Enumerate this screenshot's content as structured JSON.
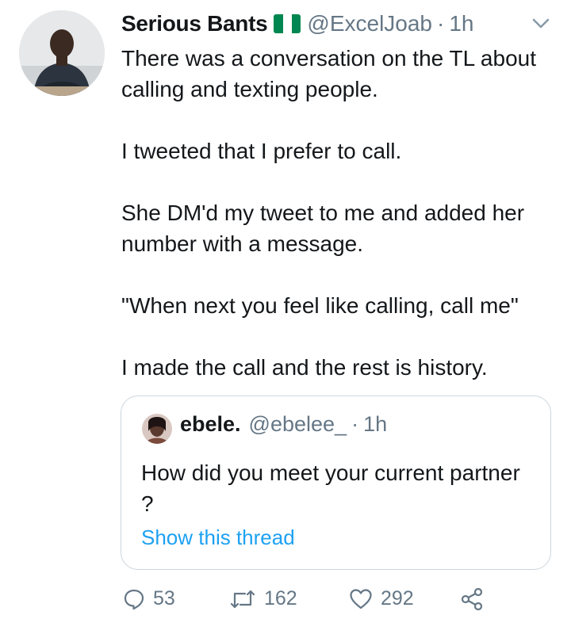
{
  "tweet": {
    "author_name": "Serious Bants",
    "flag": "nigeria-flag",
    "handle": "@ExcelJoab",
    "separator": "·",
    "time": "1h",
    "paragraphs": [
      "There was a conversation on the TL about calling and texting people.",
      "I tweeted that I prefer to call.",
      "She DM'd my tweet to me and added her number with a message.",
      "\"When next you feel like calling, call me\"",
      "I made the call and the rest is history."
    ]
  },
  "quoted": {
    "author_name": "ebele.",
    "handle": "@ebelee_",
    "separator": "·",
    "time": "1h",
    "text": "How did you meet your current partner ?",
    "link": "Show this thread"
  },
  "actions": {
    "replies": "53",
    "retweets": "162",
    "likes": "292"
  },
  "colors": {
    "text": "#14171a",
    "secondary": "#657786",
    "link": "#1da1f2",
    "border": "#ccd6dd",
    "flag_green": "#008751"
  }
}
